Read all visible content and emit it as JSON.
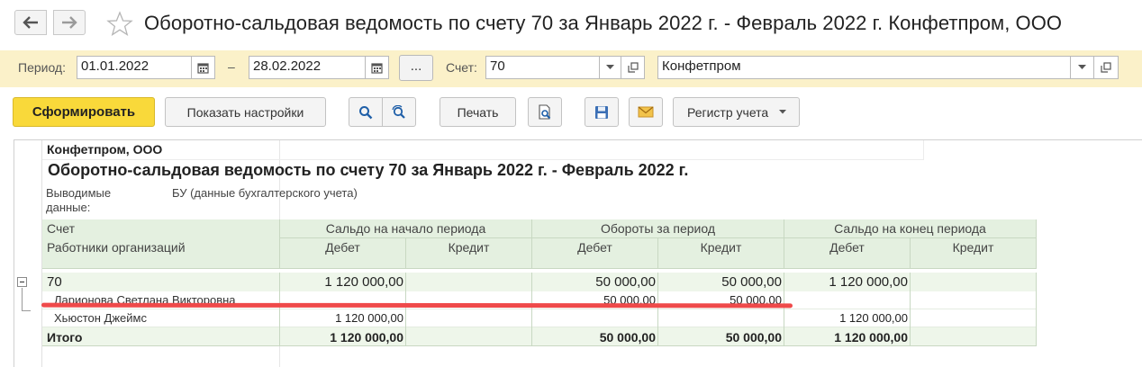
{
  "window": {
    "title": "Оборотно-сальдовая ведомость по счету 70 за Январь 2022 г. - Февраль 2022 г. Конфетпром, ООО"
  },
  "params": {
    "period_label": "Период:",
    "date_from": "01.01.2022",
    "dash": "–",
    "date_to": "28.02.2022",
    "dots_label": "...",
    "account_label": "Счет:",
    "account_value": "70",
    "organization_value": "Конфетпром"
  },
  "toolbar": {
    "generate_label": "Сформировать",
    "show_settings_label": "Показать настройки",
    "print_label": "Печать",
    "register_label": "Регистр учета"
  },
  "report": {
    "organization": "Конфетпром, ООО",
    "heading": "Оборотно-сальдовая ведомость по счету 70 за Январь 2022 г. - Февраль 2022 г.",
    "output_label_line1": "Выводимые",
    "output_label_line2": "данные:",
    "output_value": "БУ (данные бухгалтерского учета)",
    "headers": {
      "account": "Счет",
      "employees": "Работники организаций",
      "opening_balance": "Сальдо на начало периода",
      "turnover": "Обороты за период",
      "closing_balance": "Сальдо на конец периода",
      "debit": "Дебет",
      "credit": "Кредит"
    },
    "rows": [
      {
        "name": "70",
        "opening_debit": "1 120 000,00",
        "opening_credit": "",
        "turnover_debit": "50 000,00",
        "turnover_credit": "50 000,00",
        "closing_debit": "1 120 000,00",
        "closing_credit": ""
      },
      {
        "name": "Ларионова Светлана Викторовна",
        "opening_debit": "",
        "opening_credit": "",
        "turnover_debit": "50 000,00",
        "turnover_credit": "50 000,00",
        "closing_debit": "",
        "closing_credit": ""
      },
      {
        "name": "Хьюстон Джеймс",
        "opening_debit": "1 120 000,00",
        "opening_credit": "",
        "turnover_debit": "",
        "turnover_credit": "",
        "closing_debit": "1 120 000,00",
        "closing_credit": ""
      }
    ],
    "total": {
      "name": "Итого",
      "opening_debit": "1 120 000,00",
      "opening_credit": "",
      "turnover_debit": "50 000,00",
      "turnover_credit": "50 000,00",
      "closing_debit": "1 120 000,00",
      "closing_credit": ""
    }
  },
  "colors": {
    "accent_yellow": "#f9d93a",
    "param_bar": "#fbf1c9",
    "header_green": "#e4f0e0",
    "highlight_red": "#ef4a4a"
  }
}
